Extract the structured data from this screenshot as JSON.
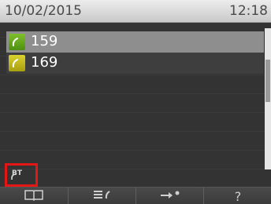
{
  "status": {
    "date": "10/02/2015",
    "time": "12:18"
  },
  "call_list": [
    {
      "number": "159",
      "icon": "handset-icon",
      "selected": true,
      "icon_color": "#6aab1f"
    },
    {
      "number": "169",
      "icon": "handset-icon",
      "selected": false,
      "icon_color": "#c9bf1c"
    }
  ],
  "indicator": {
    "label": "BT",
    "icon": "bluetooth-handset-icon",
    "highlight_color": "#e51616"
  },
  "softkeys": [
    {
      "icon": "book-icon"
    },
    {
      "icon": "list-call-icon"
    },
    {
      "icon": "transfer-icon"
    },
    {
      "icon": "help-icon",
      "label": "?"
    }
  ]
}
